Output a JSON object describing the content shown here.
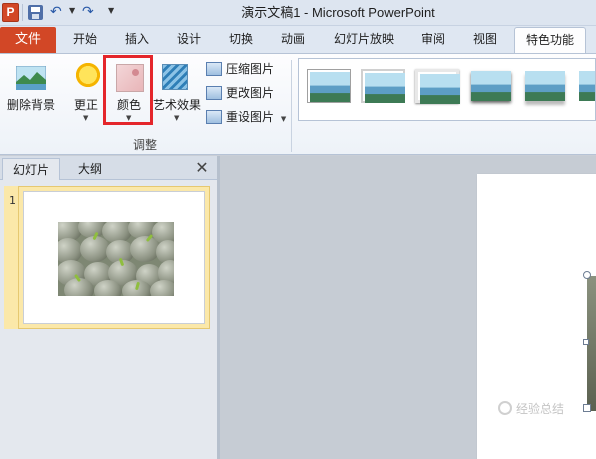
{
  "window": {
    "app_icon": "P",
    "title": "演示文稿1 - Microsoft PowerPoint",
    "qat_icons": [
      "save-icon",
      "undo-icon",
      "redo-icon",
      "customize-qat-icon"
    ]
  },
  "ribbon_tabs": {
    "file": "文件",
    "items": [
      "开始",
      "插入",
      "设计",
      "切换",
      "动画",
      "幻灯片放映",
      "审阅",
      "视图",
      "特色功能"
    ]
  },
  "ribbon": {
    "remove_background": "删除背景",
    "corrections": "更正",
    "color": "颜色",
    "artistic_effects": "艺术效果",
    "compress_pictures": "压缩图片",
    "change_picture": "更改图片",
    "reset_picture": "重设图片",
    "adjust_group_label": "调整",
    "picture_styles_count": 6,
    "accent_color": "#d24726",
    "highlight_color": "#e4262b"
  },
  "left_pane": {
    "tab_slides": "幻灯片",
    "tab_outline": "大纲",
    "close_glyph": "✕",
    "slide_number": "1"
  },
  "watermark": {
    "text": "经验总结"
  }
}
